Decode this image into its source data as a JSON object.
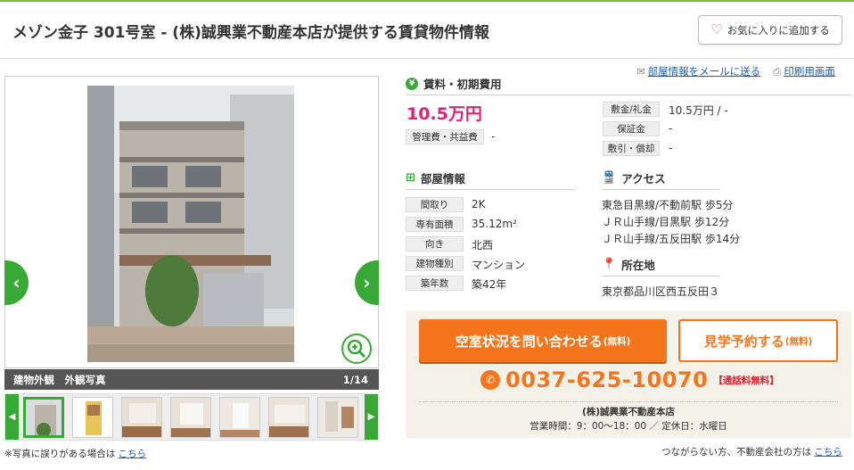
{
  "header": {
    "title": "メゾン金子 301号室 - (株)誠興業不動産本店が提供する賃貸物件情報",
    "favorite_label": "お気に入りに追加する"
  },
  "links": {
    "email": "部屋情報をメールに送る",
    "print": "印刷用画面"
  },
  "gallery": {
    "caption": "建物外観　外観写真",
    "counter": "1/14",
    "error_note": "※写真に誤りがある場合は",
    "error_link": "こちら"
  },
  "rent": {
    "heading": "賃料・初期費用",
    "price": "10.5万円",
    "mgmt_label": "管理費・共益費",
    "mgmt_value": "-",
    "deposit_label": "敷金/礼金",
    "deposit_value": "10.5万円 / -",
    "guarantee_label": "保証金",
    "guarantee_value": "-",
    "shikibiki_label": "敷引・償却",
    "shikibiki_value": "-"
  },
  "room": {
    "heading": "部屋情報",
    "rows": [
      {
        "label": "間取り",
        "value": "2K"
      },
      {
        "label": "専有面積",
        "value": "35.12m²"
      },
      {
        "label": "向き",
        "value": "北西"
      },
      {
        "label": "建物種別",
        "value": "マンション"
      },
      {
        "label": "築年数",
        "value": "築42年"
      }
    ]
  },
  "access": {
    "heading": "アクセス",
    "lines": [
      "東急目黒線/不動前駅 歩5分",
      "ＪＲ山手線/目黒駅 歩12分",
      "ＪＲ山手線/五反田駅 歩14分"
    ]
  },
  "location": {
    "heading": "所在地",
    "address": "東京都品川区西五反田３"
  },
  "contact": {
    "inquiry_label": "空室状況を問い合わせる",
    "inquiry_free": "(無料)",
    "visit_label": "見学予約する",
    "visit_free": "(無料)",
    "phone": "0037-625-10070",
    "phone_note": "【通話料無料】",
    "company": "(株)誠興業不動産本店",
    "hours": "営業時間：9：00〜18：00 ／ 定休日：水曜日"
  },
  "bottom_note": {
    "text": "つながらない方、不動産会社の方は",
    "link": "こちら"
  },
  "colors": {
    "accent_green": "#39a935",
    "price_pink": "#e61f76",
    "cta_orange": "#f4751c"
  }
}
